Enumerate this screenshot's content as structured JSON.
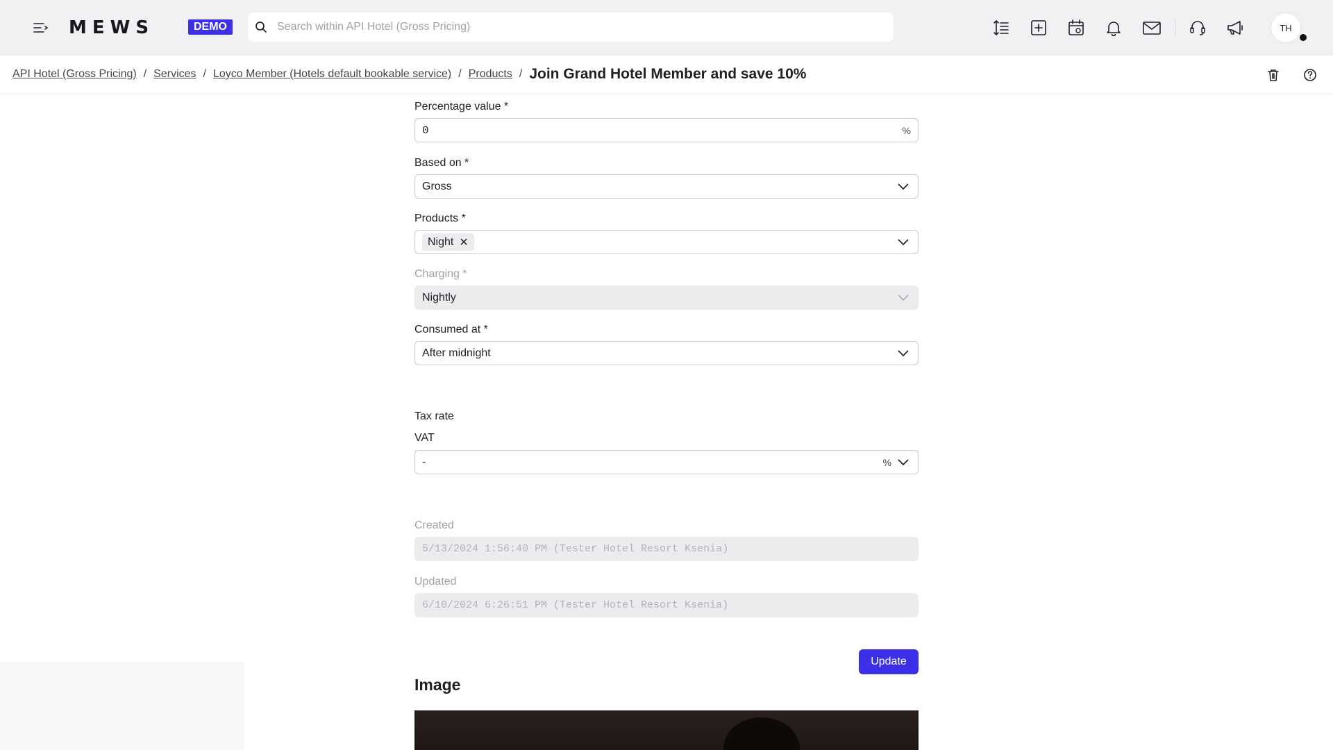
{
  "app": {
    "logo": "MEWS",
    "badge": "DEMO",
    "search_placeholder": "Search within API Hotel (Gross Pricing)",
    "avatar_initials": "TH"
  },
  "icons": {
    "menu": "menu-collapse-icon",
    "search": "search-icon",
    "toolbar": [
      "sort-lines-icon",
      "add-box-icon",
      "calendar-view-icon",
      "bell-icon",
      "mail-icon",
      "support-headset-icon",
      "megaphone-icon"
    ],
    "delete": "trash-icon",
    "help": "help-circle-icon",
    "chevron": "chevron-down-icon",
    "remove": "close-icon"
  },
  "breadcrumb": {
    "items": [
      "API Hotel (Gross Pricing)",
      "Services",
      "Loyco Member (Hotels default bookable service)",
      "Products"
    ],
    "separator": "/",
    "current": "Join Grand Hotel Member and save 10%"
  },
  "form": {
    "percentage": {
      "label": "Percentage value *",
      "value": "0",
      "suffix": "%"
    },
    "based_on": {
      "label": "Based on *",
      "value": "Gross"
    },
    "products": {
      "label": "Products *",
      "chips": [
        "Night"
      ],
      "remove": "✕"
    },
    "charging": {
      "label": "Charging *",
      "value": "Nightly"
    },
    "consumed_at": {
      "label": "Consumed at *",
      "value": "After midnight"
    },
    "tax_rate": {
      "section_label": "Tax rate",
      "label": "VAT",
      "value": "-",
      "suffix": "%"
    },
    "created": {
      "label": "Created",
      "value": "5/13/2024 1:56:40 PM (Tester Hotel Resort  Ksenia)"
    },
    "updated": {
      "label": "Updated",
      "value": "6/10/2024 6:26:51 PM (Tester Hotel Resort  Ksenia)"
    },
    "update_button": "Update",
    "image_heading": "Image"
  },
  "colors": {
    "accent": "#3b30e6",
    "topbar": "#f1f1f3",
    "disabled_field": "#ececef"
  }
}
